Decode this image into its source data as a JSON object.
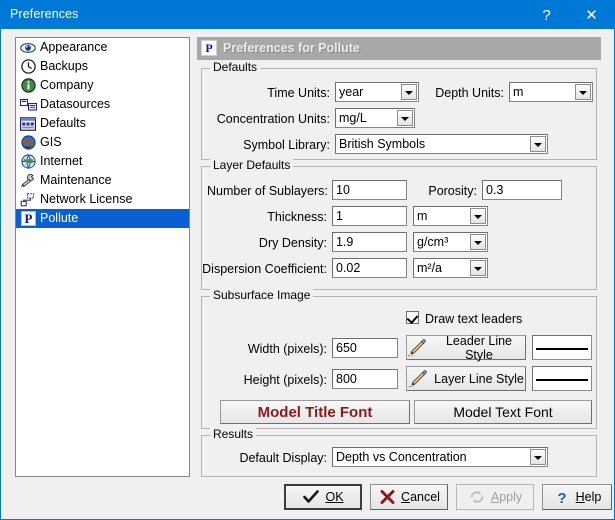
{
  "window": {
    "title": "Preferences",
    "help_button": "?",
    "close_button": "✕"
  },
  "sidebar": {
    "items": [
      {
        "label": "Appearance",
        "icon": "eye-icon",
        "selected": false
      },
      {
        "label": "Backups",
        "icon": "clock-icon",
        "selected": false
      },
      {
        "label": "Company",
        "icon": "info-globe-icon",
        "selected": false
      },
      {
        "label": "Datasources",
        "icon": "database-icon",
        "selected": false
      },
      {
        "label": "Defaults",
        "icon": "window-defaults-icon",
        "selected": false
      },
      {
        "label": "GIS",
        "icon": "globe-icon",
        "selected": false
      },
      {
        "label": "Internet",
        "icon": "internet-globe-icon",
        "selected": false
      },
      {
        "label": "Maintenance",
        "icon": "wrench-icon",
        "selected": false
      },
      {
        "label": "Network License",
        "icon": "network-icon",
        "selected": false
      },
      {
        "label": "Pollute",
        "icon": "pollute-p-icon",
        "selected": true
      }
    ]
  },
  "panel": {
    "header_title": "Preferences for Pollute",
    "header_icon_letter": "P"
  },
  "defaults": {
    "group_title": "Defaults",
    "time_units_label": "Time Units:",
    "time_units_value": "year",
    "depth_units_label": "Depth Units:",
    "depth_units_value": "m",
    "concentration_units_label": "Concentration Units:",
    "concentration_units_value": "mg/L",
    "symbol_library_label": "Symbol Library:",
    "symbol_library_value": "British Symbols"
  },
  "layer_defaults": {
    "group_title": "Layer Defaults",
    "sublayers_label": "Number of Sublayers:",
    "sublayers_value": "10",
    "porosity_label": "Porosity:",
    "porosity_value": "0.3",
    "thickness_label": "Thickness:",
    "thickness_value": "1",
    "thickness_unit": "m",
    "dry_density_label": "Dry Density:",
    "dry_density_value": "1.9",
    "dry_density_unit": "g/cm³",
    "dispersion_label": "Dispersion Coefficient:",
    "dispersion_value": "0.02",
    "dispersion_unit": "m²/a"
  },
  "subsurface": {
    "group_title": "Subsurface Image",
    "draw_text_leaders_label": "Draw text leaders",
    "draw_text_leaders_checked": true,
    "width_label": "Width (pixels):",
    "width_value": "650",
    "height_label": "Height (pixels):",
    "height_value": "800",
    "leader_line_style_button": "Leader Line Style",
    "layer_line_style_button": "Layer Line Style",
    "model_title_font_button": "Model Title Font",
    "model_text_font_button": "Model Text Font",
    "title_font_color": "#8b1a1a"
  },
  "results": {
    "group_title": "Results",
    "default_display_label": "Default Display:",
    "default_display_value": "Depth vs Concentration"
  },
  "footer": {
    "ok": "OK",
    "cancel": "Cancel",
    "apply": "Apply",
    "help": "Help",
    "apply_disabled": true
  }
}
